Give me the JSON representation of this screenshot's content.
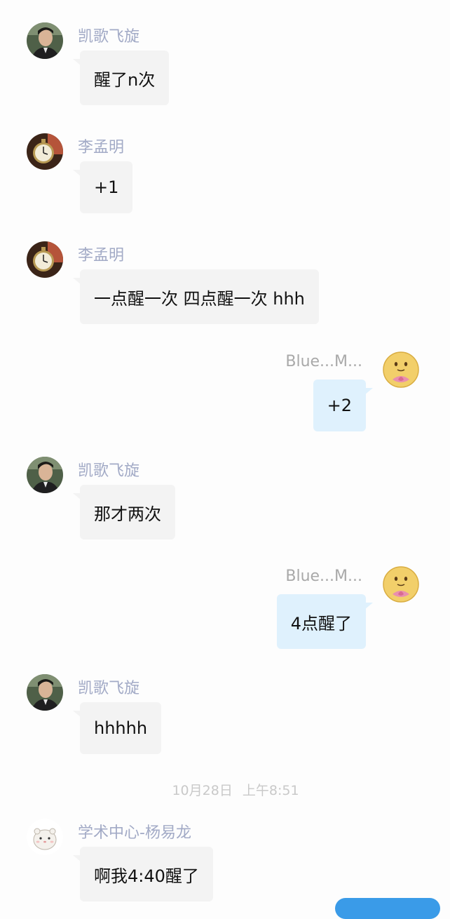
{
  "header_partial": "——",
  "messages": [
    {
      "side": "left",
      "sender": "凯歌飞旋",
      "avatar_icon": "avatar-kaige-photo",
      "text": "醒了n次"
    },
    {
      "side": "left",
      "sender": "李孟明",
      "avatar_icon": "avatar-pocket-watch",
      "text": "+1"
    },
    {
      "side": "left",
      "sender": "李孟明",
      "avatar_icon": "avatar-pocket-watch",
      "text": "一点醒一次 四点醒一次 hhh"
    },
    {
      "side": "right",
      "sender": "Blue...M...",
      "avatar_icon": "avatar-lotus-emoji",
      "text": "+2"
    },
    {
      "side": "left",
      "sender": "凯歌飞旋",
      "avatar_icon": "avatar-kaige-photo",
      "text": "那才两次"
    },
    {
      "side": "right",
      "sender": "Blue...M...",
      "avatar_icon": "avatar-lotus-emoji",
      "text": "4点醒了"
    },
    {
      "side": "left",
      "sender": "凯歌飞旋",
      "avatar_icon": "avatar-kaige-photo",
      "text": "hhhhh"
    },
    {
      "side": "left",
      "sender": "学术中心-杨易龙",
      "avatar_icon": "avatar-hamster",
      "text": "啊我4:40醒了"
    }
  ],
  "timestamp": "10月28日  上午8:51",
  "colors": {
    "incoming_bubble": "#f3f3f3",
    "outgoing_bubble": "#dff1fd",
    "sender_name_left": "#a2aac6",
    "sender_name_right": "#a9a9a9",
    "timestamp": "#c9c9c9"
  }
}
